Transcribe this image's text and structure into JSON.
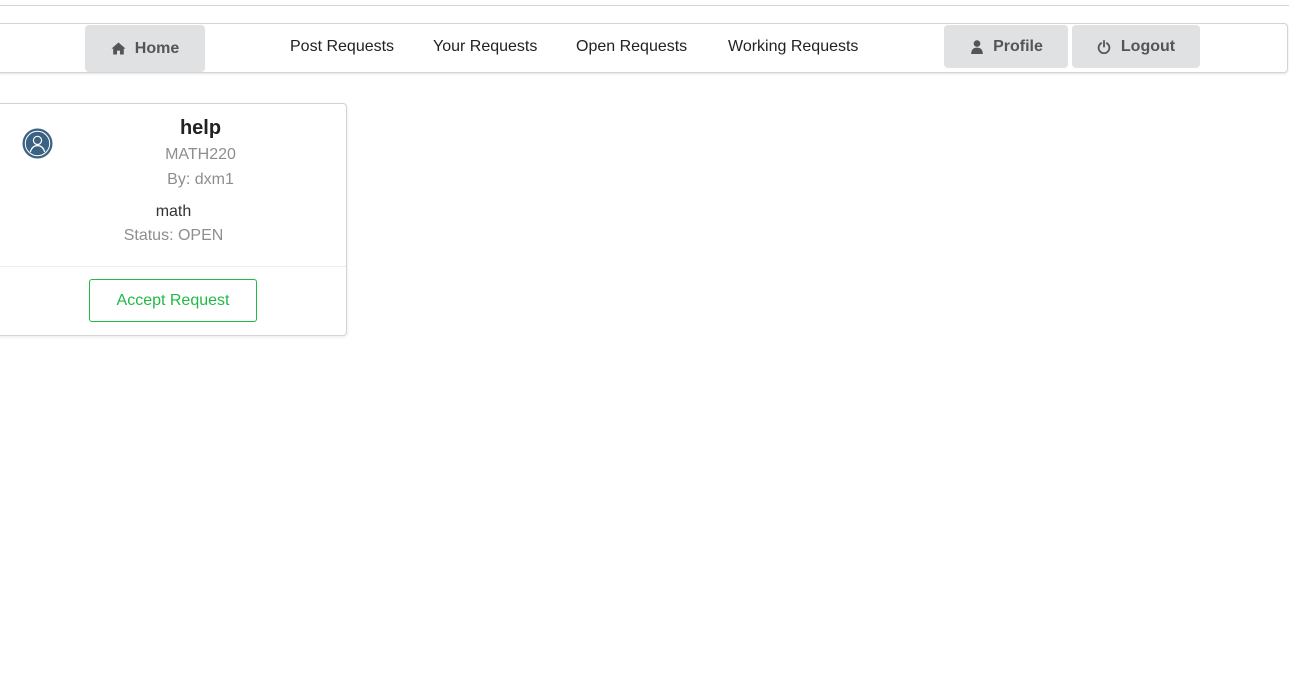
{
  "nav": {
    "home_label": "Home",
    "links": [
      "Post Requests",
      "Your Requests",
      "Open Requests",
      "Working Requests"
    ],
    "profile_label": "Profile",
    "logout_label": "Logout"
  },
  "card": {
    "title": "help",
    "course": "MATH220",
    "author": "By: dxm1",
    "description": "math",
    "status": "Status: OPEN",
    "accept_label": "Accept Request"
  },
  "colors": {
    "accent_green": "#21ba45",
    "avatar_blue": "#3b6283",
    "button_gray": "#e0e1e2"
  },
  "icons": {
    "home": "home-icon",
    "profile": "user-icon",
    "logout": "power-icon",
    "avatar": "user-circle-icon"
  }
}
